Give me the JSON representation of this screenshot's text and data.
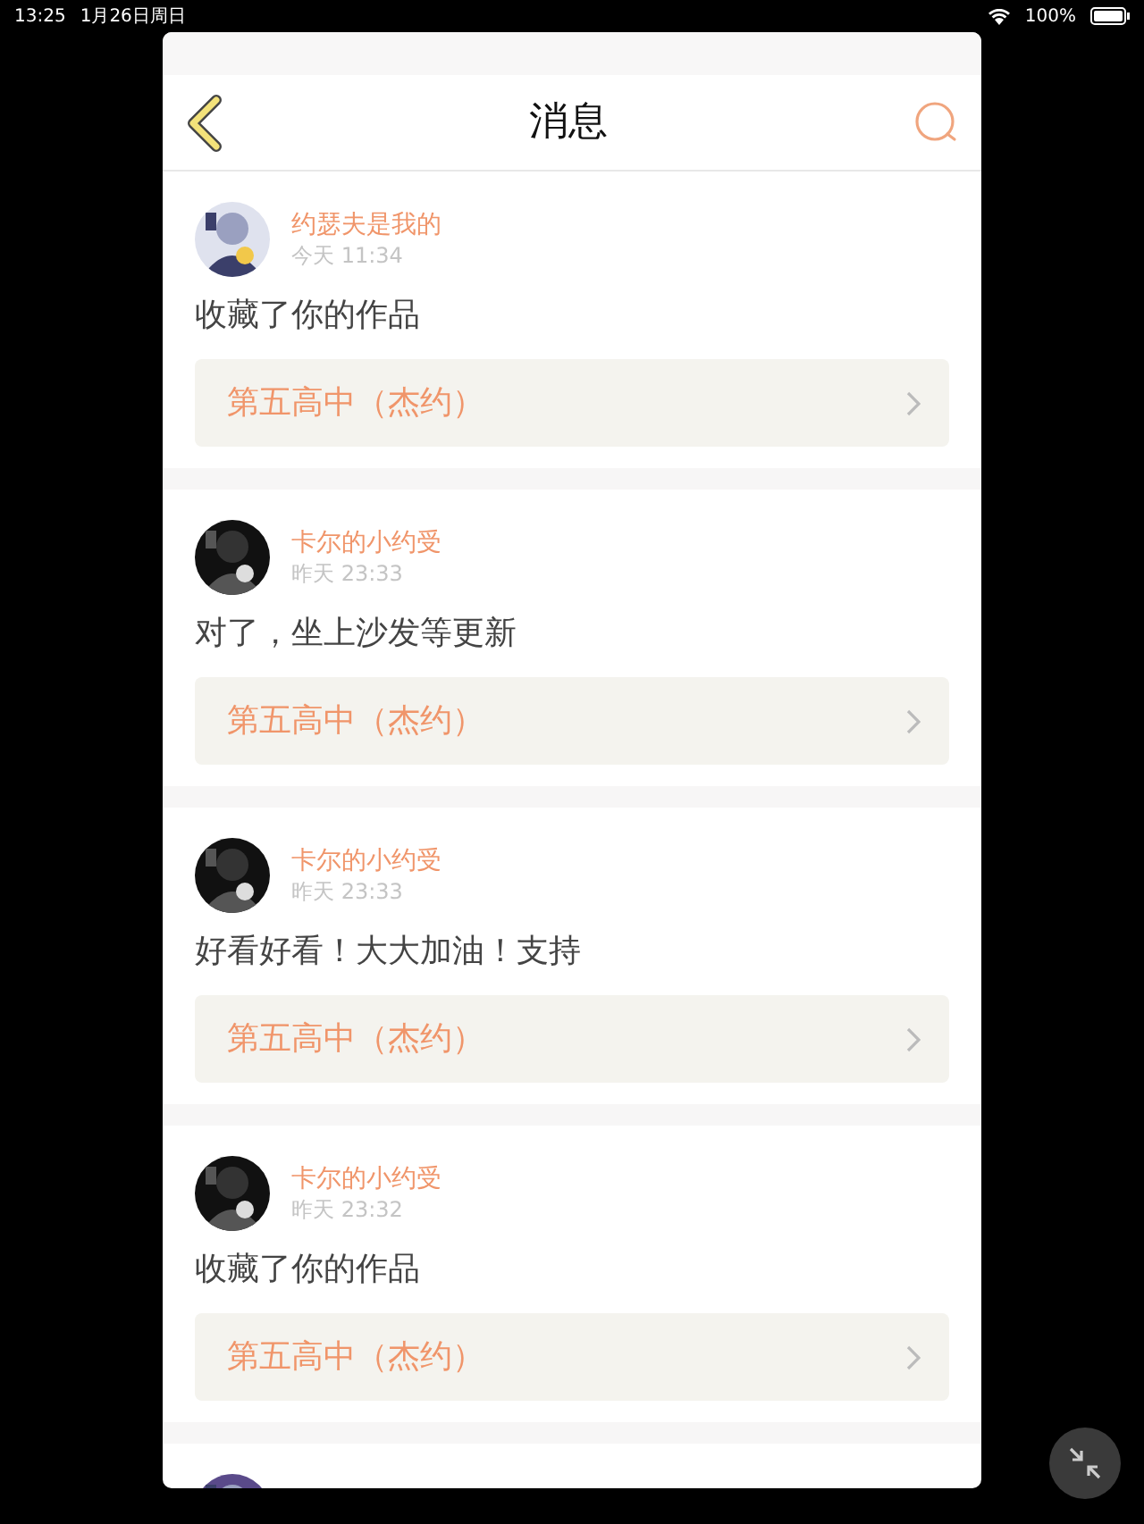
{
  "status_bar": {
    "time": "13:25",
    "date": "1月26日周日",
    "battery": "100%"
  },
  "header": {
    "title": "消息"
  },
  "messages": [
    {
      "name": "约瑟夫是我的",
      "time": "今天 11:34",
      "comment": "收藏了你的作品",
      "work": "第五高中（杰约）"
    },
    {
      "name": "卡尔的小约受",
      "time": "昨天 23:33",
      "comment": "对了，坐上沙发等更新",
      "work": "第五高中（杰约）"
    },
    {
      "name": "卡尔的小约受",
      "time": "昨天 23:33",
      "comment": "好看好看！大大加油！支持",
      "work": "第五高中（杰约）"
    },
    {
      "name": "卡尔的小约受",
      "time": "昨天 23:32",
      "comment": "收藏了你的作品",
      "work": "第五高中（杰约）"
    }
  ]
}
